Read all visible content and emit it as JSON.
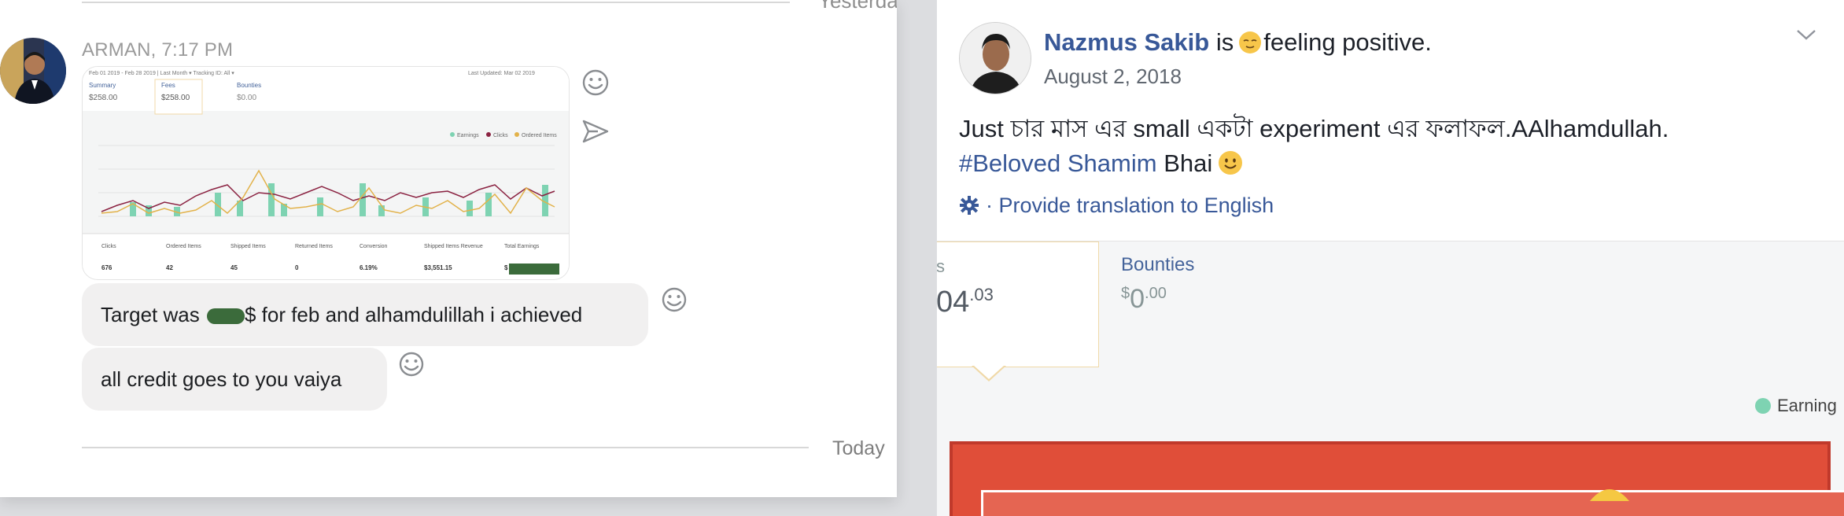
{
  "messenger": {
    "yesterday_label": "Yesterday",
    "sender_line": "ARMAN, 7:17 PM",
    "attachment": {
      "header_line": "Feb 01 2019 - Feb 28 2019  |  Last Month  ▾   Tracking ID: All ▾",
      "updated_line": "Last Updated: Mar 02 2019",
      "tabs": [
        {
          "label": "Summary",
          "value": "$258.00"
        },
        {
          "label": "Fees",
          "value": "$258.00"
        },
        {
          "label": "Bounties",
          "value": "$0.00"
        }
      ],
      "legend": [
        "Earnings",
        "Clicks",
        "Ordered Items"
      ],
      "table_headers": [
        "Clicks",
        "Ordered Items",
        "Shipped Items",
        "Returned Items",
        "Conversion",
        "Shipped Items Revenue",
        "Total Earnings"
      ],
      "table_values": [
        "676",
        "42",
        "45",
        "0",
        "6.19%",
        "$3,551.15",
        "$"
      ]
    },
    "message_1_before": "Target was ",
    "message_1_after": "$ for feb and alhamdulillah i achieved",
    "message_2": "all credit goes to you vaiya",
    "today_label": "Today",
    "colors": {
      "bubble": "#f1f0f0",
      "icon": "#8a8d91"
    }
  },
  "post": {
    "author": "Nazmus Sakib",
    "is_text": "is",
    "feeling_text": "feeling positive.",
    "date": "August 2, 2018",
    "body_line_1": "Just চার মাস এর small একটা experiment এর ফলাফল.AAlhamdullah.",
    "hashtag": "#Beloved Shamim",
    "body_line_2_rest": "Bhai",
    "translate_text": "· Provide translation to English",
    "image": {
      "card_left_label": "s",
      "card_left_value": "04",
      "card_left_cents": ".03",
      "bounties_label": "Bounties",
      "bounties_currency": "$",
      "bounties_value": "0",
      "bounties_cents": ".00",
      "legend_label": "Earning"
    },
    "colors": {
      "link": "#385898",
      "text": "#1d2129",
      "muted": "#606770"
    }
  }
}
